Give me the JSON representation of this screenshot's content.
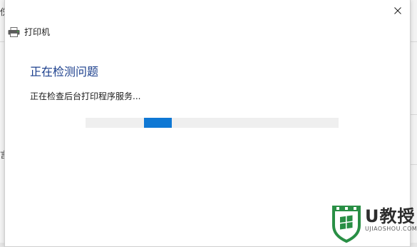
{
  "background_window": {
    "glyph_top_left": "伤",
    "glyph_mid_left": "言"
  },
  "dialog": {
    "title": "打印机",
    "heading": "正在检测问题",
    "status": "正在检查后台打印程序服务...",
    "progress": {
      "indeterminate": true,
      "segment_start": 0.23,
      "segment_end": 0.34
    },
    "accent_color": "#0f78d4",
    "heading_color": "#1a3e8c",
    "close_icon": "close-icon",
    "title_icon": "printer-icon"
  },
  "watermark": {
    "brand": "U教授",
    "domain": "UJIAOSHOU.COM",
    "icon": "shield-windows-icon",
    "color": "#1e8a3c"
  }
}
